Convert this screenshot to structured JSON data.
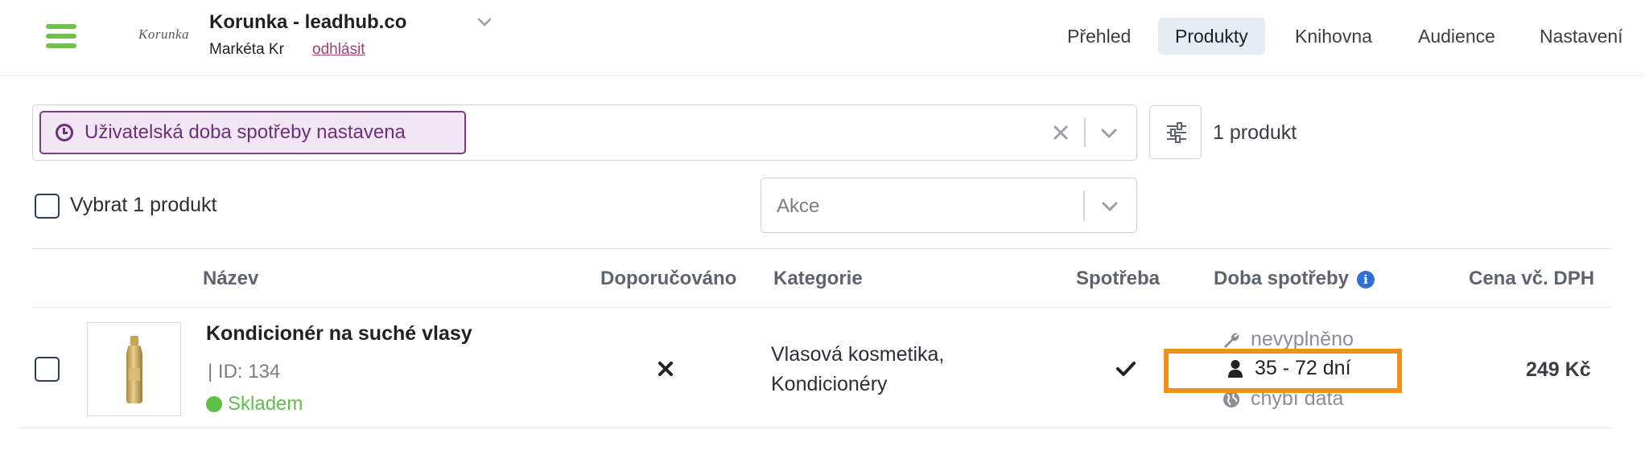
{
  "header": {
    "brand_logo_text": "Korunka",
    "account_name": "Korunka - leadhub.co",
    "user_name": "Markéta Kr",
    "logout_label": "odhlásit"
  },
  "nav": {
    "items": [
      {
        "label": "Přehled",
        "active": false
      },
      {
        "label": "Produkty",
        "active": true
      },
      {
        "label": "Knihovna",
        "active": false
      },
      {
        "label": "Audience",
        "active": false
      },
      {
        "label": "Nastavení",
        "active": false
      }
    ]
  },
  "filter": {
    "tag_label": "Uživatelská doba spotřeby nastavena",
    "product_count": "1 produkt"
  },
  "selection": {
    "select_all_label": "Vybrat 1 produkt",
    "action_placeholder": "Akce"
  },
  "table": {
    "columns": [
      "Název",
      "Doporučováno",
      "Kategorie",
      "Spotřeba",
      "Doba spotřeby",
      "Cena vč. DPH"
    ],
    "rows": [
      {
        "name": "Kondicionér na suché vlasy",
        "id_text": "| ID: 134",
        "stock": "Skladem",
        "recommended": "no",
        "category_line1": "Vlasová kosmetika,",
        "category_line2": "Kondicionéry",
        "consumption": "yes",
        "duration_options": [
          "nevyplněno",
          "35 - 72 dní",
          "chybí data"
        ],
        "duration_selected": "35 - 72 dní",
        "price": "249 Kč"
      }
    ]
  },
  "colors": {
    "accent_green": "#6cc24a",
    "filter_purple": "#6e2f7a",
    "highlight_orange": "#f39019",
    "info_blue": "#2f6fd8",
    "logout_link": "#a4416d"
  }
}
